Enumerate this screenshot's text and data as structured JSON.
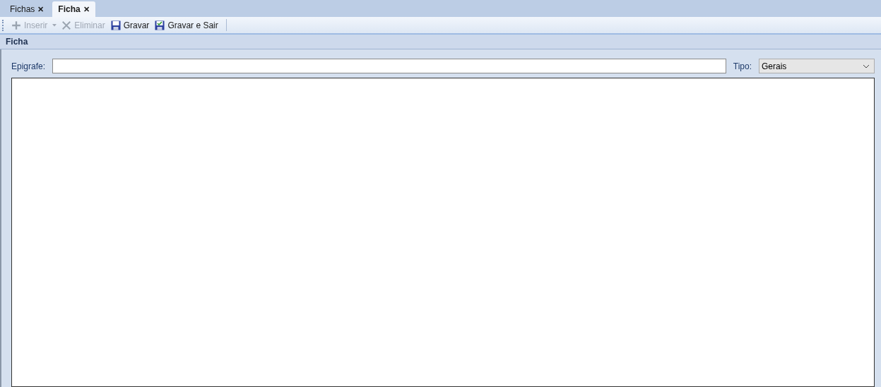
{
  "tabs": [
    {
      "label": "Fichas",
      "close": "✕",
      "selected": false
    },
    {
      "label": "Ficha",
      "close": "✕",
      "selected": true
    }
  ],
  "toolbar": [
    {
      "kind": "plus",
      "label": "Inserir",
      "disabled": true,
      "dropdown": true
    },
    {
      "kind": "cross",
      "label": "Eliminar",
      "disabled": true,
      "dropdown": false
    },
    {
      "kind": "save",
      "label": "Gravar",
      "disabled": false,
      "dropdown": false
    },
    {
      "kind": "save-check",
      "label": "Gravar e Sair",
      "disabled": false,
      "dropdown": false
    }
  ],
  "section": {
    "title": "Ficha"
  },
  "form": {
    "epigrafe_label": "Epigrafe:",
    "tipo_label": "Tipo:",
    "tipo_value": "Gerais"
  }
}
